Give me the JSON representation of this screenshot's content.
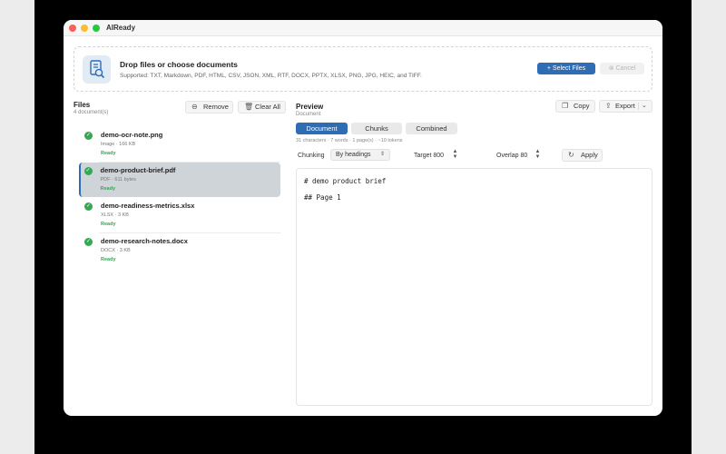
{
  "app": {
    "title": "AIReady"
  },
  "dropzone": {
    "title": "Drop files or choose documents",
    "supported": "Supported: TXT, Markdown, PDF, HTML, CSV, JSON, XML, RTF, DOCX, PPTX, XLSX, PNG, JPG, HEIC, and TIFF.",
    "select_label": "Select Files",
    "cancel_label": "Cancel"
  },
  "files": {
    "title": "Files",
    "count": "4 document(s)",
    "remove_label": "Remove",
    "clear_label": "Clear All",
    "items": [
      {
        "name": "demo-ocr-note.png",
        "meta": "Image · 166 KB",
        "status": "Ready"
      },
      {
        "name": "demo-product-brief.pdf",
        "meta": "PDF · 611 bytes",
        "status": "Ready"
      },
      {
        "name": "demo-readiness-metrics.xlsx",
        "meta": "XLSX · 3 KB",
        "status": "Ready"
      },
      {
        "name": "demo-research-notes.docx",
        "meta": "DOCX · 3 KB",
        "status": "Ready"
      }
    ]
  },
  "preview": {
    "title": "Preview",
    "subtitle": "Document",
    "copy_label": "Copy",
    "export_label": "Export",
    "tabs": [
      "Document",
      "Chunks",
      "Combined"
    ],
    "active_tab": "Document",
    "stats": "31 characters · 7 words · 1 page(s) · ~10 tokens",
    "chunking_label": "Chunking",
    "chunking_value": "By headings",
    "target_label": "Target 800",
    "overlap_label": "Overlap 80",
    "apply_label": "Apply",
    "content_lines": [
      "# demo product brief",
      "## Page 1"
    ]
  },
  "colors": {
    "accent": "#2e6db4",
    "ready": "#34a853"
  }
}
